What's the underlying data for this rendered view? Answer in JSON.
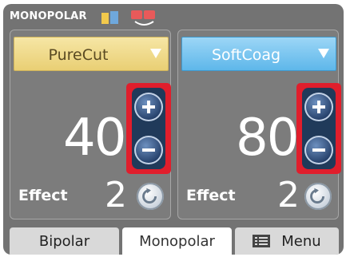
{
  "status": {
    "mode_title": "MONOPOLAR"
  },
  "panels": {
    "cut": {
      "mode": "PureCut",
      "power": "40",
      "effect_label": "Effect",
      "effect": "2"
    },
    "coag": {
      "mode": "SoftCoag",
      "power": "80",
      "effect_label": "Effect",
      "effect": "2"
    }
  },
  "tabs": [
    {
      "label": "Bipolar"
    },
    {
      "label": "Monopolar"
    },
    {
      "label": "Menu"
    }
  ],
  "colors": {
    "cut_accent": "#e9cf74",
    "coag_accent": "#5eb7ea",
    "highlight": "#e01e2c",
    "frame": "#737373"
  },
  "icons": [
    "battery-icon",
    "footswitch-icon",
    "caret-down-icon",
    "plus-icon",
    "minus-icon",
    "cycle-icon",
    "menu-list-icon"
  ]
}
